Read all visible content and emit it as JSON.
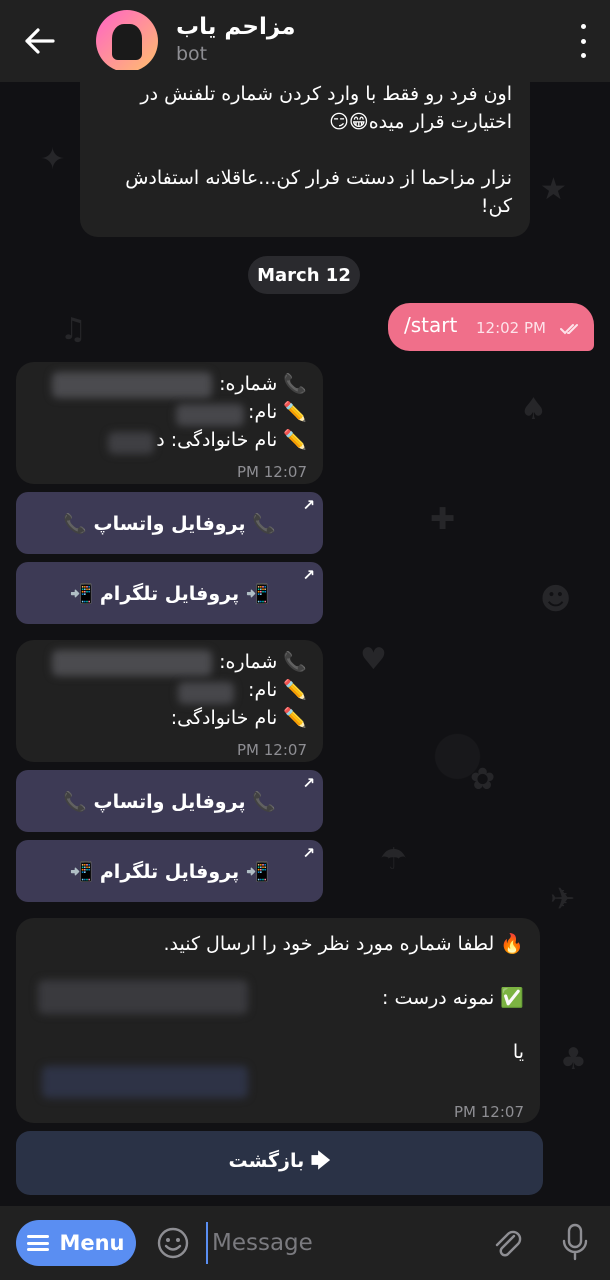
{
  "header": {
    "title": "مزاحم یاب",
    "subtitle": "bot"
  },
  "intro_message": {
    "line1": "اون فرد رو فقط با وارد کردن شماره تلفنش در",
    "line2": "اختیارت قرار میده😁😏",
    "line3": "نزار مزاحما از دستت فرار کن...عاقلانه استفادش",
    "line4": "کن!"
  },
  "date_separator": "March 12",
  "outgoing": {
    "text": "/start",
    "time": "12:02 PM"
  },
  "result_cards": [
    {
      "phone_label": "📞 شماره:",
      "name_label": "✏️ نام:",
      "family_label": "✏️ نام خانوادگی: ﺩ",
      "time": "12:07 PM",
      "whatsapp_button": "📞 پروفایل واتساپ 📞",
      "telegram_button": "📲 پروفایل تلگرام 📲"
    },
    {
      "phone_label": "📞 شماره:",
      "name_label": "✏️ نام:",
      "family_label": "✏️ نام خانوادگی:",
      "time": "12:07 PM",
      "whatsapp_button": "📞 پروفایل واتساپ 📞",
      "telegram_button": "📲 پروفایل تلگرام 📲"
    }
  ],
  "prompt_message": {
    "line1": "🔥 لطفا شماره مورد نظر خود را ارسال کنید.",
    "line2": "✅ نمونه درست :",
    "line3": "یا",
    "time": "12:07 PM"
  },
  "back_button": "🡆 بازگشت",
  "input_bar": {
    "menu_label": "Menu",
    "placeholder": "Message"
  },
  "colors": {
    "accent": "#5a8ef2",
    "outgoing_bubble": "#f06f8a",
    "incoming_bubble": "#212121",
    "inline_button": "#3d3a55"
  }
}
